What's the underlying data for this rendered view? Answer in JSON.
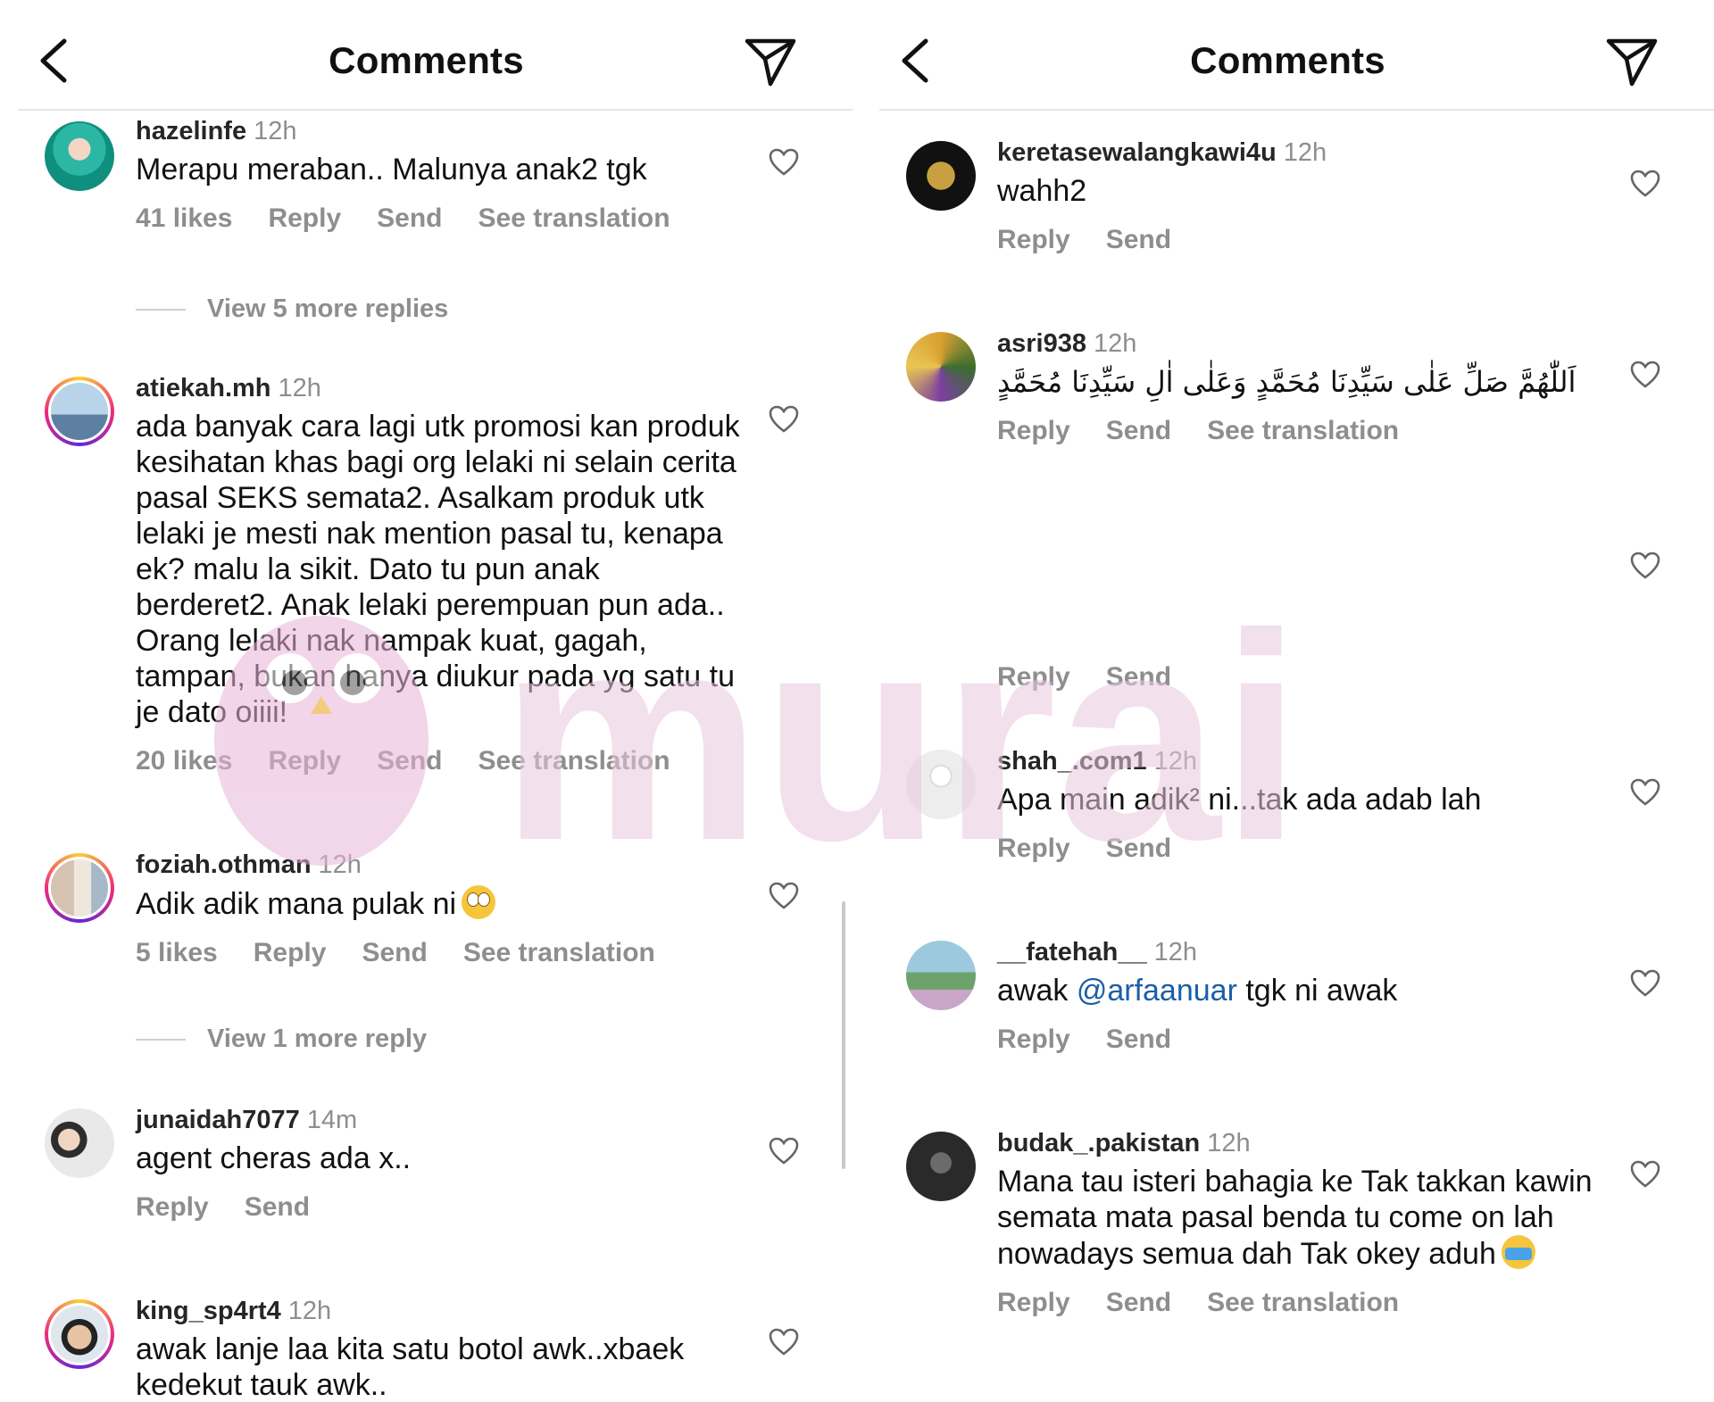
{
  "left_panel": {
    "title": "Comments",
    "comments": [
      {
        "user": "hazelinfe",
        "time": "12h",
        "text": "Merapu meraban.. Malunya anak2 tgk",
        "likes": "41 likes",
        "reply": "Reply",
        "send": "Send",
        "translate": "See translation",
        "more_replies": "View 5 more replies"
      },
      {
        "user": "atiekah.mh",
        "time": "12h",
        "text": "ada banyak cara lagi utk promosi kan produk kesihatan khas bagi org lelaki ni selain cerita pasal SEKS semata2. Asalkam produk utk lelaki je mesti nak mention pasal tu, kenapa ek? malu la sikit. Dato tu pun anak berderet2. Anak lelaki perempuan pun ada.. Orang lelaki nak nampak kuat, gagah, tampan, bukan hanya diukur pada yg satu tu je dato oiiii!",
        "likes": "20 likes",
        "reply": "Reply",
        "send": "Send",
        "translate": "See translation"
      },
      {
        "user": "foziah.othman",
        "time": "12h",
        "text": "Adik adik mana pulak ni",
        "likes": "5 likes",
        "reply": "Reply",
        "send": "Send",
        "translate": "See translation",
        "more_replies": "View 1 more reply"
      },
      {
        "user": "junaidah7077",
        "time": "14m",
        "text": "agent cheras ada x..",
        "reply": "Reply",
        "send": "Send"
      },
      {
        "user": "king_sp4rt4",
        "time": "12h",
        "text": "awak lanje laa kita satu botol awk..xbaek kedekut tauk awk.."
      }
    ]
  },
  "right_panel": {
    "title": "Comments",
    "comments": [
      {
        "user": "keretasewalangkawi4u",
        "time": "12h",
        "text": "wahh2",
        "reply": "Reply",
        "send": "Send"
      },
      {
        "user": "asri938",
        "time": "12h",
        "text": "اَللّٰهُمَّ صَلِّ عَلٰى سَيِّدِنَا مُحَمَّدٍ وَعَلٰى اٰلِ سَيِّدِنَا مُحَمَّدٍ",
        "reply": "Reply",
        "send": "Send",
        "translate": "See translation"
      },
      {
        "reply": "Reply",
        "send": "Send"
      },
      {
        "user": "shah_.com1",
        "time": "12h",
        "text": "Apa main adik² ni...tak ada adab lah",
        "reply": "Reply",
        "send": "Send"
      },
      {
        "user": "__fatehah__",
        "time": "12h",
        "text_before": "awak ",
        "mention": "@arfaanuar",
        "text_after": " tgk ni awak",
        "reply": "Reply",
        "send": "Send"
      },
      {
        "user": "budak_.pakistan",
        "time": "12h",
        "text": "Mana tau isteri bahagia ke Tak takkan kawin semata mata pasal benda tu come on lah nowadays semua dah Tak okey aduh",
        "reply": "Reply",
        "send": "Send",
        "translate": "See translation"
      }
    ]
  },
  "watermark": {
    "text": "murai"
  },
  "icons": {
    "back": "chevron-left-icon",
    "share": "paper-plane-icon",
    "like": "heart-outline-icon"
  },
  "colors": {
    "mention": "#1b5ea6",
    "secondary_text": "#8e8e8e",
    "watermark": "#e8c8de"
  }
}
